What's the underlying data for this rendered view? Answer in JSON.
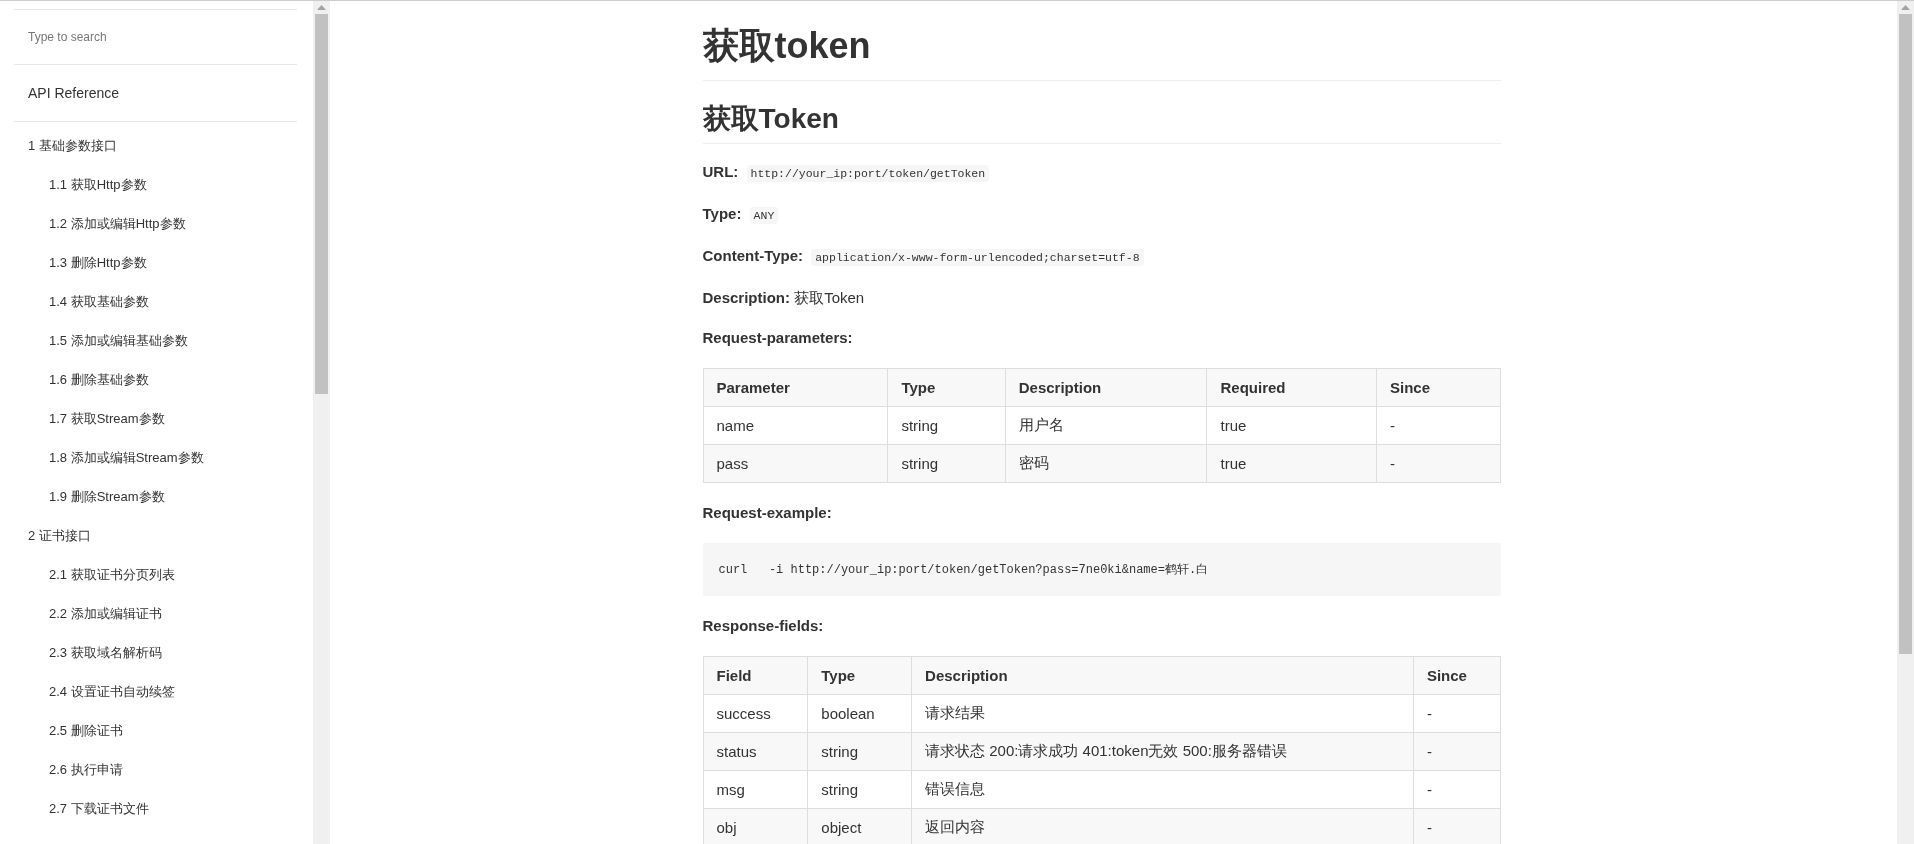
{
  "sidebar": {
    "search": {
      "placeholder": "Type to search"
    },
    "title": "API Reference",
    "items": [
      {
        "label": "1 基础参数接口",
        "children": [
          {
            "label": "1.1 获取Http参数"
          },
          {
            "label": "1.2 添加或编辑Http参数"
          },
          {
            "label": "1.3 删除Http参数"
          },
          {
            "label": "1.4 获取基础参数"
          },
          {
            "label": "1.5 添加或编辑基础参数"
          },
          {
            "label": "1.6 删除基础参数"
          },
          {
            "label": "1.7 获取Stream参数"
          },
          {
            "label": "1.8 添加或编辑Stream参数"
          },
          {
            "label": "1.9 删除Stream参数"
          }
        ]
      },
      {
        "label": "2 证书接口",
        "children": [
          {
            "label": "2.1 获取证书分页列表"
          },
          {
            "label": "2.2 添加或编辑证书"
          },
          {
            "label": "2.3 获取域名解析码"
          },
          {
            "label": "2.4 设置证书自动续签"
          },
          {
            "label": "2.5 删除证书"
          },
          {
            "label": "2.6 执行申请"
          },
          {
            "label": "2.7 下载证书文件"
          }
        ]
      }
    ]
  },
  "content": {
    "blocks": [
      {
        "kind": "h1",
        "text": "获取token"
      },
      {
        "kind": "h2",
        "text": "获取Token"
      },
      {
        "kind": "field",
        "label": "URL:",
        "code": "http://your_ip:port/token/getToken"
      },
      {
        "kind": "field",
        "label": "Type:",
        "code": "ANY"
      },
      {
        "kind": "field",
        "label": "Content-Type:",
        "code": "application/x-www-form-urlencoded;charset=utf-8"
      },
      {
        "kind": "field",
        "label": "Description:",
        "text": "获取Token"
      },
      {
        "kind": "label",
        "text": "Request-parameters:"
      },
      {
        "kind": "table",
        "columns": [
          "Parameter",
          "Type",
          "Description",
          "Required",
          "Since"
        ],
        "rows": [
          [
            "name",
            "string",
            "用户名",
            "true",
            "-"
          ],
          [
            "pass",
            "string",
            "密码",
            "true",
            "-"
          ]
        ]
      },
      {
        "kind": "label",
        "text": "Request-example:"
      },
      {
        "kind": "code",
        "text": "curl   -i http://your_ip:port/token/getToken?pass=7ne0ki&name=鹤轩.白"
      },
      {
        "kind": "label",
        "text": "Response-fields:"
      },
      {
        "kind": "table",
        "columns": [
          "Field",
          "Type",
          "Description",
          "Since"
        ],
        "rows": [
          [
            "success",
            "boolean",
            "请求结果",
            "-"
          ],
          [
            "status",
            "string",
            "请求状态 200:请求成功 401:token无效 500:服务器错误",
            "-"
          ],
          [
            "msg",
            "string",
            "错误信息",
            "-"
          ],
          [
            "obj",
            "object",
            "返回内容",
            "-"
          ]
        ]
      }
    ]
  }
}
